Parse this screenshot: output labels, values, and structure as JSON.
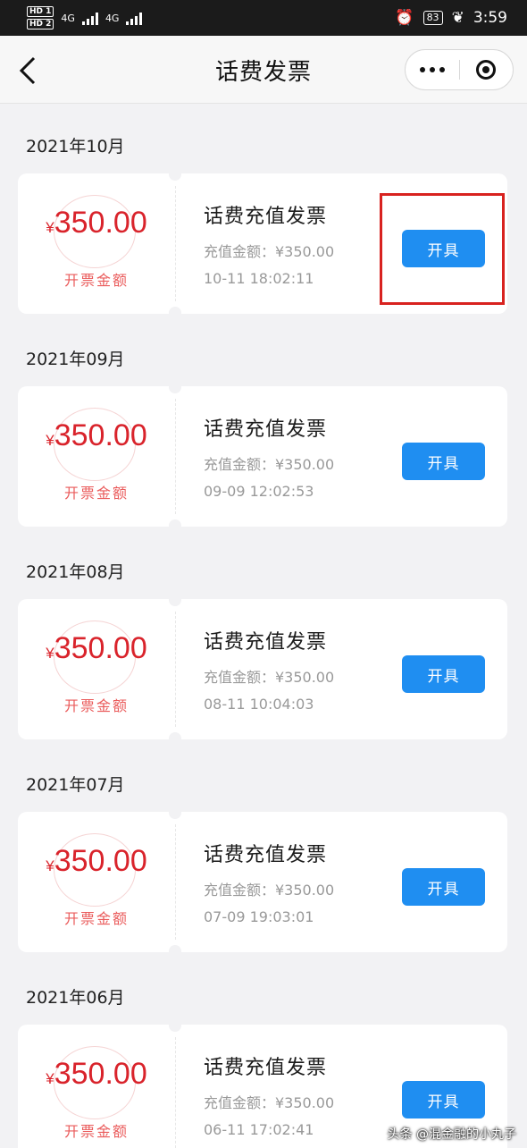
{
  "status_bar": {
    "sim1": "HD 1",
    "sim2": "HD 2",
    "network1": "4G",
    "network2": "4G",
    "battery": "83",
    "time": "3:59"
  },
  "navbar": {
    "title": "话费发票",
    "back_icon": "chevron-left-icon",
    "more_icon": "more-dots-icon",
    "close_icon": "target-circle-icon"
  },
  "groups": [
    {
      "month": "2021年10月",
      "currency": "¥",
      "amount": "350.00",
      "amount_label": "开票金额",
      "title": "话费充值发票",
      "recharge_amount": "充值金额：¥350.00",
      "datetime": "10-11 18:02:11",
      "button": "开具",
      "highlighted": true
    },
    {
      "month": "2021年09月",
      "currency": "¥",
      "amount": "350.00",
      "amount_label": "开票金额",
      "title": "话费充值发票",
      "recharge_amount": "充值金额：¥350.00",
      "datetime": "09-09 12:02:53",
      "button": "开具"
    },
    {
      "month": "2021年08月",
      "currency": "¥",
      "amount": "350.00",
      "amount_label": "开票金额",
      "title": "话费充值发票",
      "recharge_amount": "充值金额：¥350.00",
      "datetime": "08-11 10:04:03",
      "button": "开具"
    },
    {
      "month": "2021年07月",
      "currency": "¥",
      "amount": "350.00",
      "amount_label": "开票金额",
      "title": "话费充值发票",
      "recharge_amount": "充值金额：¥350.00",
      "datetime": "07-09 19:03:01",
      "button": "开具"
    },
    {
      "month": "2021年06月",
      "currency": "¥",
      "amount": "350.00",
      "amount_label": "开票金额",
      "title": "话费充值发票",
      "recharge_amount": "充值金额：¥350.00",
      "datetime": "06-11 17:02:41",
      "button": "开具"
    }
  ],
  "watermark": "头条 @混金融的小丸子",
  "colors": {
    "accent_blue": "#1f8ef1",
    "amount_red": "#d9232b",
    "highlight_red": "#d8221f"
  }
}
